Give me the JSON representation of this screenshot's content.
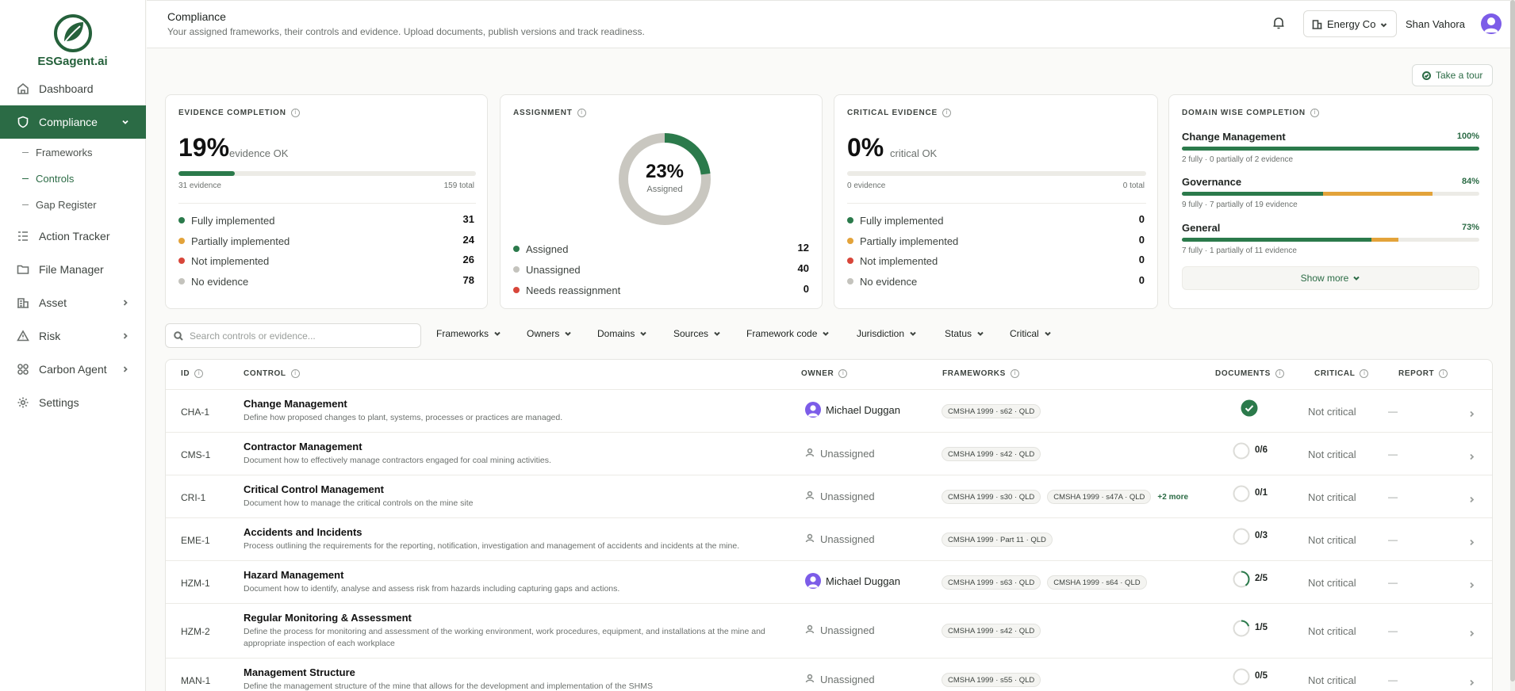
{
  "brand": {
    "name": "ESGagent.ai"
  },
  "sidebar": {
    "items": [
      {
        "label": "Dashboard",
        "icon": "home-icon"
      },
      {
        "label": "Compliance",
        "icon": "shield-icon",
        "active": true
      },
      {
        "label": "Action Tracker",
        "icon": "tracker-icon"
      },
      {
        "label": "File Manager",
        "icon": "folder-icon"
      },
      {
        "label": "Asset",
        "icon": "building-icon"
      },
      {
        "label": "Risk",
        "icon": "warning-icon"
      },
      {
        "label": "Carbon Agent",
        "icon": "grid-icon"
      },
      {
        "label": "Settings",
        "icon": "gear-icon"
      }
    ],
    "sub_items": [
      {
        "label": "Frameworks"
      },
      {
        "label": "Controls",
        "active": true
      },
      {
        "label": "Gap Register"
      }
    ]
  },
  "header": {
    "title": "Compliance",
    "subtitle": "Your assigned frameworks, their controls and evidence. Upload documents, publish versions and track readiness.",
    "org": "Energy Co",
    "user": "Shan Vahora"
  },
  "tour_button": "Take a tour",
  "cards": {
    "evidence": {
      "title": "EVIDENCE COMPLETION",
      "pct": "19%",
      "pct_sub": "evidence OK",
      "progress": 0.19,
      "left_cap": "31 evidence",
      "right_cap": "159 total",
      "legend": [
        {
          "label": "Fully implemented",
          "value": "31",
          "color": "#2b7a4b"
        },
        {
          "label": "Partially implemented",
          "value": "24",
          "color": "#e3a33a"
        },
        {
          "label": "Not implemented",
          "value": "26",
          "color": "#d8463a"
        },
        {
          "label": "No evidence",
          "value": "78",
          "color": "#c4c3bd"
        }
      ]
    },
    "assignment": {
      "title": "ASSIGNMENT",
      "pct": "23%",
      "pct_label": "Assigned",
      "progress": 0.23,
      "legend": [
        {
          "label": "Assigned",
          "value": "12",
          "color": "#2b7a4b"
        },
        {
          "label": "Unassigned",
          "value": "40",
          "color": "#c4c3bd"
        },
        {
          "label": "Needs reassignment",
          "value": "0",
          "color": "#d8463a"
        }
      ]
    },
    "critical": {
      "title": "CRITICAL EVIDENCE",
      "pct": "0%",
      "pct_sub": "critical OK",
      "progress": 0,
      "left_cap": "0 evidence",
      "right_cap": "0 total",
      "legend": [
        {
          "label": "Fully implemented",
          "value": "0",
          "color": "#2b7a4b"
        },
        {
          "label": "Partially implemented",
          "value": "0",
          "color": "#e3a33a"
        },
        {
          "label": "Not implemented",
          "value": "0",
          "color": "#d8463a"
        },
        {
          "label": "No evidence",
          "value": "0",
          "color": "#c4c3bd"
        }
      ]
    },
    "domain": {
      "title": "DOMAIN WISE COMPLETION",
      "rows": [
        {
          "name": "Change Management",
          "pct": "100%",
          "full": 1.0,
          "partial": 0.0,
          "caption": "2 fully · 0 partially of 2 evidence"
        },
        {
          "name": "Governance",
          "pct": "84%",
          "full": 0.474,
          "partial": 0.368,
          "caption": "9 fully · 7 partially of 19 evidence"
        },
        {
          "name": "General",
          "pct": "73%",
          "full": 0.636,
          "partial": 0.091,
          "caption": "7 fully · 1 partially of 11 evidence"
        }
      ],
      "show_more": "Show more"
    }
  },
  "filters": {
    "search_placeholder": "Search controls or evidence...",
    "items": [
      "Frameworks",
      "Owners",
      "Domains",
      "Sources",
      "Framework code",
      "Jurisdiction",
      "Status",
      "Critical"
    ]
  },
  "table": {
    "headers": {
      "id": "ID",
      "control": "CONTROL",
      "owner": "OWNER",
      "frameworks": "FRAMEWORKS",
      "documents": "DOCUMENTS",
      "critical": "CRITICAL",
      "report": "REPORT"
    },
    "rows": [
      {
        "id": "CHA-1",
        "name": "Change Management",
        "desc": "Define how proposed changes to plant, systems, processes or practices are managed.",
        "owner": "Michael Duggan",
        "assigned": true,
        "frameworks": [
          "CMSHA 1999 · s62 · QLD"
        ],
        "more": "",
        "docs": "",
        "doc_done": 1,
        "doc_complete": true,
        "critical": "Not critical",
        "report": "—"
      },
      {
        "id": "CMS-1",
        "name": "Contractor Management",
        "desc": "Document how to effectively manage contractors engaged for coal mining activities.",
        "owner": "Unassigned",
        "assigned": false,
        "frameworks": [
          "CMSHA 1999 · s42 · QLD"
        ],
        "more": "",
        "docs": "0/6",
        "doc_done": 0,
        "critical": "Not critical",
        "report": "—"
      },
      {
        "id": "CRI-1",
        "name": "Critical Control Management",
        "desc": "Document how to manage the critical controls on the mine site",
        "owner": "Unassigned",
        "assigned": false,
        "frameworks": [
          "CMSHA 1999 · s30 · QLD",
          "CMSHA 1999 · s47A · QLD"
        ],
        "more": "+2 more",
        "docs": "0/1",
        "doc_done": 0,
        "critical": "Not critical",
        "report": "—"
      },
      {
        "id": "EME-1",
        "name": "Accidents and Incidents",
        "desc": "Process outlining the requirements for the reporting, notification, investigation and management of accidents and incidents at the mine.",
        "owner": "Unassigned",
        "assigned": false,
        "frameworks": [
          "CMSHA 1999 · Part 11 · QLD"
        ],
        "more": "",
        "docs": "0/3",
        "doc_done": 0,
        "critical": "Not critical",
        "report": "—"
      },
      {
        "id": "HZM-1",
        "name": "Hazard Management",
        "desc": "Document how to identify, analyse and assess risk from hazards including capturing gaps and actions.",
        "owner": "Michael Duggan",
        "assigned": true,
        "frameworks": [
          "CMSHA 1999 · s63 · QLD",
          "CMSHA 1999 · s64 · QLD"
        ],
        "more": "",
        "docs": "2/5",
        "doc_done": 0.4,
        "critical": "Not critical",
        "report": "—"
      },
      {
        "id": "HZM-2",
        "name": "Regular Monitoring & Assessment",
        "desc": "Define the process for monitoring and assessment of the working environment, work procedures, equipment, and installations at the mine and appropriate inspection of each workplace",
        "owner": "Unassigned",
        "assigned": false,
        "frameworks": [
          "CMSHA 1999 · s42 · QLD"
        ],
        "more": "",
        "docs": "1/5",
        "doc_done": 0.2,
        "critical": "Not critical",
        "report": "—"
      },
      {
        "id": "MAN-1",
        "name": "Management Structure",
        "desc": "Define the management structure of the mine that allows for the development and implementation of the SHMS",
        "owner": "Unassigned",
        "assigned": false,
        "frameworks": [
          "CMSHA 1999 · s55 · QLD"
        ],
        "more": "",
        "docs": "0/5",
        "doc_done": 0,
        "critical": "Not critical",
        "report": "—"
      }
    ]
  }
}
